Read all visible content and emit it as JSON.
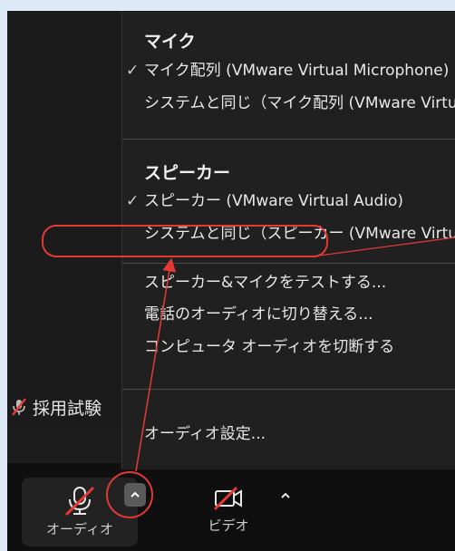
{
  "participant": {
    "name": "採用試験"
  },
  "menu": {
    "mic_section": {
      "title": "マイク",
      "items": [
        {
          "label": "マイク配列 (VMware Virtual Microphone)",
          "checked": true
        },
        {
          "label": "システムと同じ（マイク配列 (VMware Virtual Microphone)）",
          "checked": false
        }
      ]
    },
    "speaker_section": {
      "title": "スピーカー",
      "items": [
        {
          "label": "スピーカー (VMware Virtual Audio)",
          "checked": true
        },
        {
          "label": "システムと同じ（スピーカー (VMware Virtual Audio)）",
          "checked": false
        }
      ]
    },
    "actions": [
      {
        "label": "スピーカー&マイクをテストする..."
      },
      {
        "label": "電話のオーディオに切り替える..."
      },
      {
        "label": "コンピュータ オーディオを切断する"
      }
    ],
    "settings_label": "オーディオ設定..."
  },
  "toolbar": {
    "audio_label": "オーディオ",
    "video_label": "ビデオ"
  },
  "colors": {
    "annotation_red": "#e53935",
    "menu_bg": "#202020",
    "toolbar_bg": "#0f0f0f"
  }
}
